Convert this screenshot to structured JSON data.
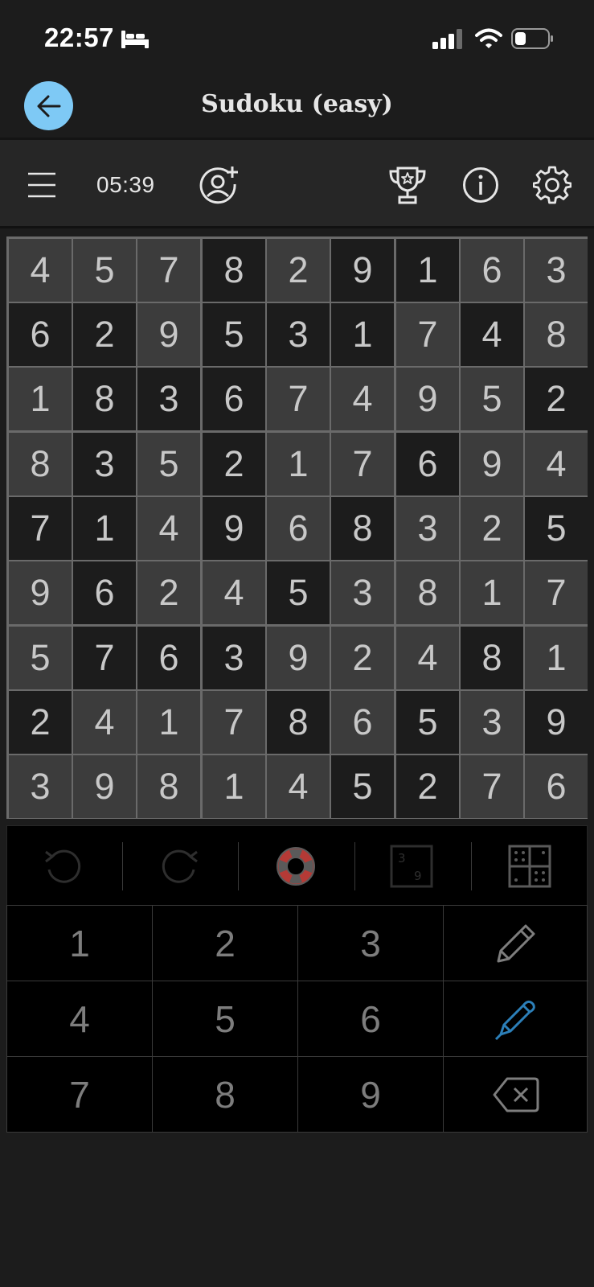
{
  "status_bar": {
    "time": "22:57"
  },
  "title_bar": {
    "title": "Sudoku (easy)"
  },
  "toolbar": {
    "timer": "05:39"
  },
  "icons": {
    "back": "arrow-left-icon",
    "menu": "hamburger-menu-icon",
    "add_user": "add-user-icon",
    "trophy": "trophy-icon",
    "info": "info-icon",
    "settings": "gear-icon",
    "undo": "undo-icon",
    "redo": "redo-icon",
    "hint": "lifebuoy-icon",
    "notes": "candidate-notes-icon",
    "grid_toggle": "grid-icon",
    "pencil": "pencil-icon",
    "pen": "pen-icon",
    "erase": "backspace-icon"
  },
  "colors": {
    "accent": "#7ec9f5",
    "pen_active": "#2c7fb8",
    "hint_red": "#b53a36"
  },
  "board": {
    "rows": [
      [
        "4",
        "5",
        "7",
        "8",
        "2",
        "9",
        "1",
        "6",
        "3"
      ],
      [
        "6",
        "2",
        "9",
        "5",
        "3",
        "1",
        "7",
        "4",
        "8"
      ],
      [
        "1",
        "8",
        "3",
        "6",
        "7",
        "4",
        "9",
        "5",
        "2"
      ],
      [
        "8",
        "3",
        "5",
        "2",
        "1",
        "7",
        "6",
        "9",
        "4"
      ],
      [
        "7",
        "1",
        "4",
        "9",
        "6",
        "8",
        "3",
        "2",
        "5"
      ],
      [
        "9",
        "6",
        "2",
        "4",
        "5",
        "3",
        "8",
        "1",
        "7"
      ],
      [
        "5",
        "7",
        "6",
        "3",
        "9",
        "2",
        "4",
        "8",
        "1"
      ],
      [
        "2",
        "4",
        "1",
        "7",
        "8",
        "6",
        "5",
        "3",
        "9"
      ],
      [
        "3",
        "9",
        "8",
        "1",
        "4",
        "5",
        "2",
        "7",
        "6"
      ]
    ],
    "shade": [
      [
        "L",
        "L",
        "L",
        "D",
        "L",
        "D",
        "D",
        "L",
        "L"
      ],
      [
        "D",
        "D",
        "L",
        "D",
        "D",
        "D",
        "L",
        "D",
        "L"
      ],
      [
        "L",
        "D",
        "D",
        "D",
        "L",
        "L",
        "L",
        "L",
        "D"
      ],
      [
        "L",
        "D",
        "L",
        "D",
        "L",
        "L",
        "D",
        "L",
        "L"
      ],
      [
        "D",
        "D",
        "L",
        "D",
        "L",
        "D",
        "L",
        "L",
        "D"
      ],
      [
        "L",
        "D",
        "L",
        "L",
        "D",
        "L",
        "L",
        "L",
        "L"
      ],
      [
        "L",
        "D",
        "D",
        "D",
        "L",
        "L",
        "L",
        "D",
        "L"
      ],
      [
        "D",
        "L",
        "L",
        "L",
        "D",
        "L",
        "D",
        "L",
        "D"
      ],
      [
        "L",
        "L",
        "L",
        "L",
        "L",
        "D",
        "D",
        "L",
        "L"
      ]
    ]
  },
  "keypad": {
    "digits": [
      "1",
      "2",
      "3",
      "4",
      "5",
      "6",
      "7",
      "8",
      "9"
    ]
  }
}
